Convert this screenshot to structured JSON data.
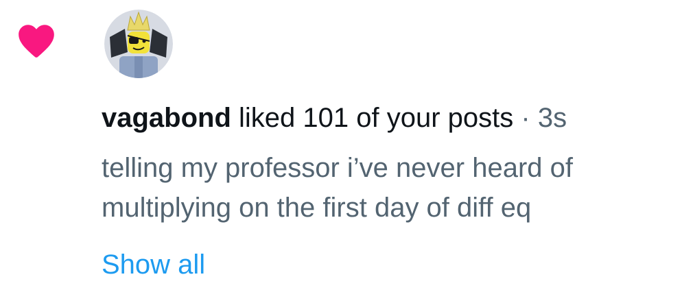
{
  "notification": {
    "icon": "heart-icon",
    "icon_color": "#f91880",
    "avatar": "user-avatar-icon",
    "username": "vagabond",
    "action_text": "liked 101 of your posts",
    "separator": "·",
    "timestamp": "3s",
    "post_preview": "telling my professor i’ve never heard of multiplying on the first day of diff eq",
    "show_all_label": "Show all",
    "link_color": "#1d9bf0"
  }
}
